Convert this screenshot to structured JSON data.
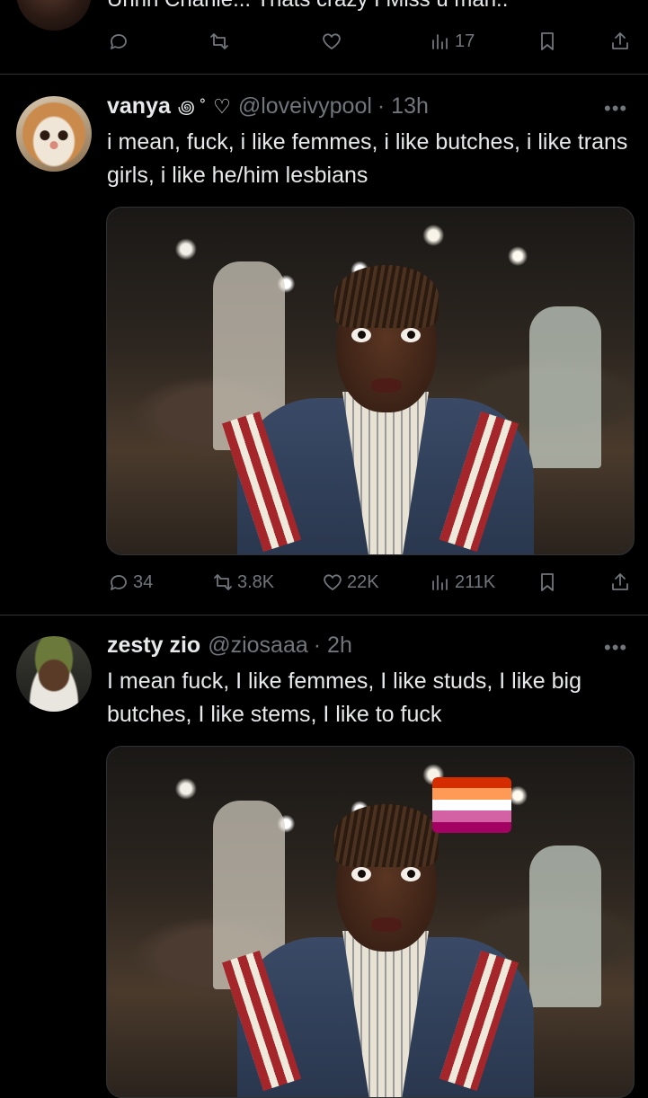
{
  "top_tweet": {
    "text_partial": "Uhhh Charlie... Thats crazy I Miss u man..",
    "views": "17"
  },
  "tweets": [
    {
      "name": "vanya",
      "name_symbol": "꩜ ˚",
      "handle": "@loveivypool",
      "time": "· 13h",
      "text": "i mean, fuck, i like femmes, i like butches, i like trans girls, i like he/him lesbians",
      "replies": "34",
      "retweets": "3.8K",
      "likes": "22K",
      "views": "211K"
    },
    {
      "name": "zesty zio",
      "handle": "@ziosaaa",
      "time": "· 2h",
      "text": "I mean fuck, I like femmes, I like studs, I like big butches, I like stems, I like to fuck"
    }
  ],
  "flag_colors": [
    "#d52d00",
    "#ff9a56",
    "#ffffff",
    "#d362a4",
    "#a30262"
  ],
  "icons": {
    "reply": "reply-icon",
    "retweet": "retweet-icon",
    "like": "heart-icon",
    "views": "views-icon",
    "bookmark": "bookmark-icon",
    "share": "share-icon",
    "more": "more-icon"
  }
}
